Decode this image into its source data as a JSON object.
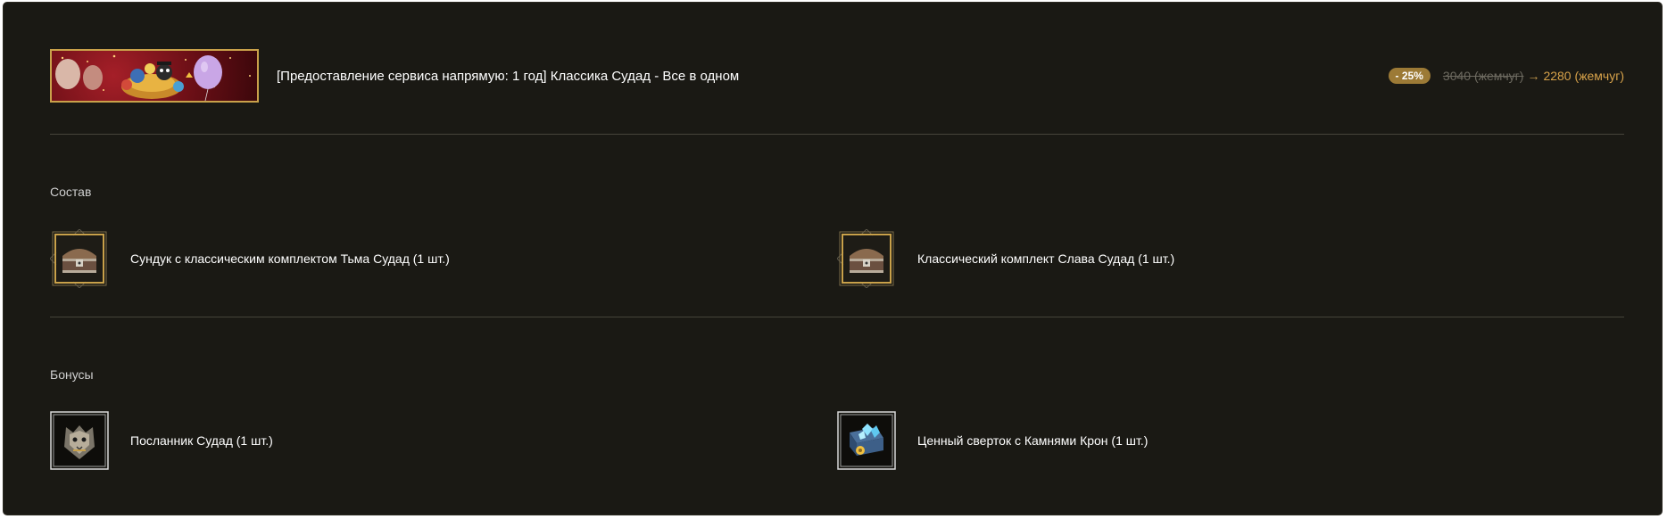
{
  "product": {
    "title": "[Предоставление сервиса напрямую: 1 год] Классика Судад - Все в одном",
    "discount": "- 25%",
    "old_price": "3040 (жемчуг)",
    "arrow": "→",
    "new_price": "2280 (жемчуг)",
    "banner_icon": "party-banner-image"
  },
  "composition": {
    "label": "Состав",
    "items": [
      {
        "label": "Сундук с классическим комплектом Тьма Судад (1 шт.)",
        "icon": "treasure-chest-icon"
      },
      {
        "label": "Классический комплект Слава Судад (1 шт.)",
        "icon": "treasure-chest-icon"
      }
    ]
  },
  "bonuses": {
    "label": "Бонусы",
    "items": [
      {
        "label": "Посланник Судад (1 шт.)",
        "icon": "beast-messenger-icon"
      },
      {
        "label": "Ценный сверток с Камнями Крон (1 шт.)",
        "icon": "crystal-bundle-icon"
      }
    ]
  },
  "colors": {
    "panel_bg": "#1a1914",
    "accent_gold": "#c9a14a",
    "new_price": "#d7a24a",
    "old_price": "#6d6a60",
    "divider": "#46443a"
  }
}
